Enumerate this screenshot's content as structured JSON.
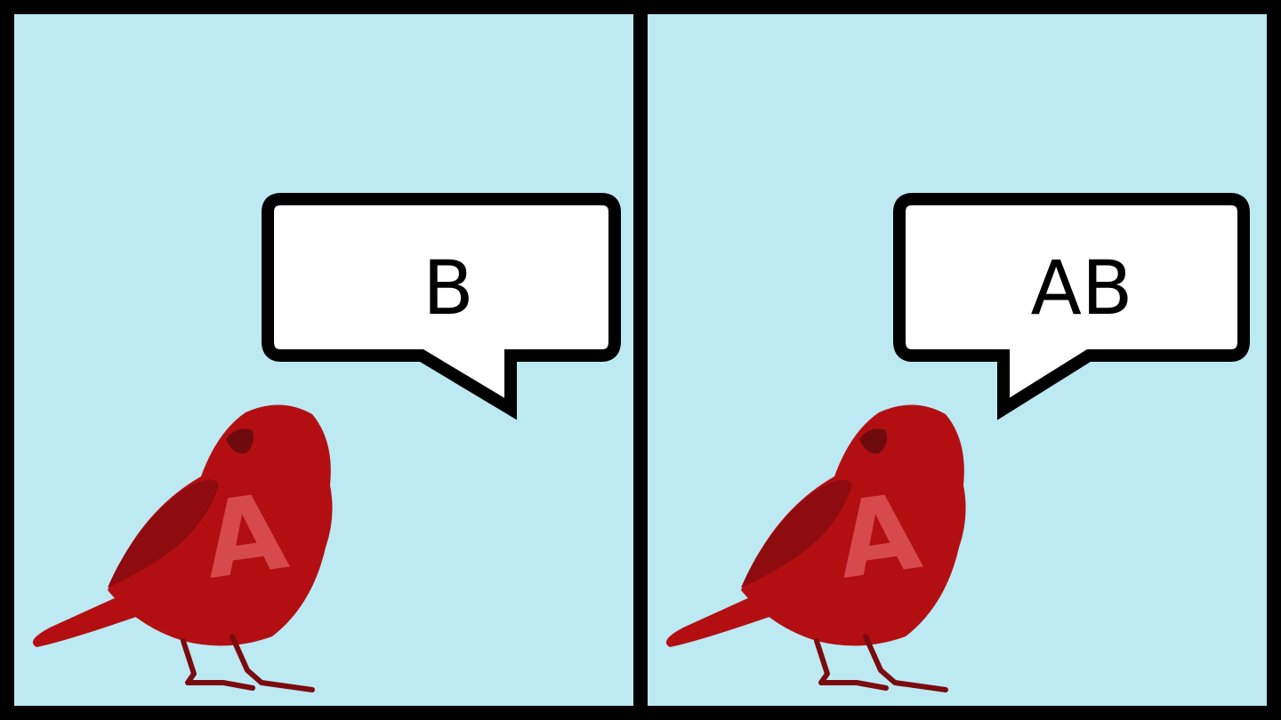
{
  "panels": [
    {
      "speech": "B",
      "bird_label": "A"
    },
    {
      "speech": "AB",
      "bird_label": "A"
    }
  ],
  "colors": {
    "sky": "#bde9f3",
    "border": "#000000",
    "bird_body": "#b30f13",
    "bird_wing": "#8e0b10",
    "bird_letter": "#d64a4e",
    "bubble_fill": "#ffffff"
  },
  "icons": {
    "bird": "red-bird-icon",
    "bubble": "speech-bubble-icon"
  }
}
